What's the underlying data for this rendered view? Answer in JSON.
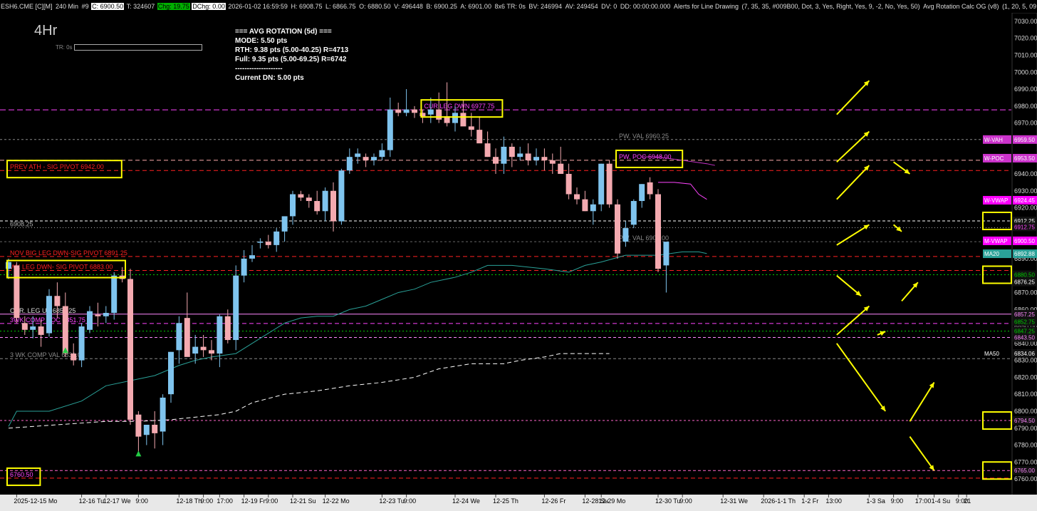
{
  "header": {
    "symbol": "ESH6.CME [C][M]",
    "interval": "240 Min",
    "bar_no": "#9",
    "close": "C: 6900.50",
    "total": "T: 324607",
    "change": "Chg: 19.75",
    "dchange": "DChg: 0.00",
    "datetime": "2026-01-02 16:59:59",
    "high": "H: 6908.75",
    "low": "L: 6866.75",
    "open": "O: 6880.50",
    "volume": "V: 496448",
    "bid": "B: 6900.25",
    "ask": "A: 6901.00",
    "bar_info": "8x6 TR: 0s",
    "bv": "BV: 246994",
    "av": "AV: 249454",
    "dv": "DV: 0",
    "dd": "DD: 00:00:00.000",
    "alerts": "Alerts for Line Drawing",
    "study_params": "(7, 35, 35, #009B00, Dot, 3, Yes, Right, Yes, 9, -2, No, Yes, 50)",
    "study2": "Avg Rotation Calc OG (v8)",
    "study2_params": "(1, 20, 5, 09:30:00, 16:00:00, 35"
  },
  "timeframe_label": "4Hr",
  "tr_label": "TR: 0s",
  "avg_rotation": {
    "title": "=== AVG ROTATION (5d) ===",
    "mode": "MODE: 5.50 pts",
    "rth": "RTH:  9.38 pts  (5.00-40.25) R=4713",
    "full": "Full: 9.35 pts  (5.00-69.25) R=6742",
    "sep": "--------------------",
    "current": "Current DN: 5.00 pts"
  },
  "colors": {
    "up_candle": "#7fc4ee",
    "down_candle": "#f4aab0",
    "level_red": "#ff2020",
    "level_magenta": "#ff44ff",
    "highlight": "#ffff00",
    "teal_line": "#2aa198"
  },
  "chart_data": {
    "type": "candlestick",
    "ylim": [
      6755,
      7035
    ],
    "y_ticks": [
      "7030.00",
      "7020.00",
      "7010.00",
      "7000.00",
      "6990.00",
      "6980.00",
      "6970.00",
      "6960.00",
      "6950.00",
      "6940.00",
      "6930.00",
      "6920.00",
      "6910.00",
      "6900.00",
      "6890.00",
      "6880.00",
      "6870.00",
      "6860.00",
      "6850.00",
      "6840.00",
      "6830.00",
      "6820.00",
      "6810.00",
      "6800.00",
      "6790.00",
      "6780.00",
      "6770.00",
      "6760.00"
    ],
    "x_labels": [
      {
        "i": 1,
        "t": "2025-12-15 Mo"
      },
      {
        "i": 9,
        "t": "12-16 Tu"
      },
      {
        "i": 12,
        "t": "12-17 We"
      },
      {
        "i": 16,
        "t": "9:00"
      },
      {
        "i": 21,
        "t": "12-18 Th"
      },
      {
        "i": 24,
        "t": "9:00"
      },
      {
        "i": 26,
        "t": "17:00"
      },
      {
        "i": 29,
        "t": "12-19 Fr"
      },
      {
        "i": 32,
        "t": "9:00"
      },
      {
        "i": 35,
        "t": "12-21 Su"
      },
      {
        "i": 39,
        "t": "12-22 Mo"
      },
      {
        "i": 46,
        "t": "12-23 Tu"
      },
      {
        "i": 49,
        "t": "9:00"
      },
      {
        "i": 55,
        "t": "12-24 We"
      },
      {
        "i": 60,
        "t": "12-25 Th"
      },
      {
        "i": 66,
        "t": "12-26 Fr"
      },
      {
        "i": 71,
        "t": "12-28 Su"
      },
      {
        "i": 73,
        "t": "12-29 Mo"
      },
      {
        "i": 80,
        "t": "12-30 Tu"
      },
      {
        "i": 83,
        "t": "9:00"
      },
      {
        "i": 88,
        "t": "12-31 We"
      },
      {
        "i": 93,
        "t": "2026-1-1 Th"
      },
      {
        "i": 98,
        "t": "1-2 Fr"
      },
      {
        "i": 101,
        "t": "13:00"
      },
      {
        "i": 106,
        "t": "1-3 Sa"
      },
      {
        "i": 109,
        "t": "9:00"
      },
      {
        "i": 112,
        "t": "17:00"
      },
      {
        "i": 114,
        "t": "1-4 Su"
      },
      {
        "i": 117,
        "t": "9:00"
      },
      {
        "i": 118,
        "t": "21"
      }
    ],
    "candles": [
      [
        6884,
        6890,
        6878,
        6888
      ],
      [
        6886,
        6888,
        6852,
        6855
      ],
      [
        6852,
        6856,
        6845,
        6848
      ],
      [
        6848,
        6856,
        6843,
        6850
      ],
      [
        6850,
        6854,
        6838,
        6845
      ],
      [
        6846,
        6872,
        6844,
        6868
      ],
      [
        6868,
        6876,
        6855,
        6862
      ],
      [
        6862,
        6870,
        6832,
        6834
      ],
      [
        6834,
        6840,
        6827,
        6830
      ],
      [
        6830,
        6852,
        6826,
        6850
      ],
      [
        6848,
        6862,
        6846,
        6859
      ],
      [
        6857,
        6864,
        6850,
        6856
      ],
      [
        6856,
        6862,
        6852,
        6858
      ],
      [
        6858,
        6882,
        6854,
        6880
      ],
      [
        6880,
        6885,
        6876,
        6878
      ],
      [
        6878,
        6884,
        6792,
        6795
      ],
      [
        6798,
        6800,
        6775,
        6785
      ],
      [
        6786,
        6792,
        6780,
        6792
      ],
      [
        6792,
        6800,
        6778,
        6787
      ],
      [
        6788,
        6810,
        6780,
        6808
      ],
      [
        6810,
        6835,
        6805,
        6835
      ],
      [
        6836,
        6856,
        6828,
        6852
      ],
      [
        6855,
        6870,
        6836,
        6832
      ],
      [
        6834,
        6845,
        6828,
        6838
      ],
      [
        6838,
        6845,
        6832,
        6836
      ],
      [
        6836,
        6842,
        6830,
        6834
      ],
      [
        6834,
        6857,
        6826,
        6856
      ],
      [
        6856,
        6860,
        6840,
        6842
      ],
      [
        6842,
        6886,
        6836,
        6880
      ],
      [
        6880,
        6895,
        6876,
        6890
      ],
      [
        6890,
        6898,
        6888,
        6892
      ],
      [
        6900,
        6902,
        6896,
        6900
      ],
      [
        6900,
        6904,
        6896,
        6898
      ],
      [
        6898,
        6908,
        6894,
        6906
      ],
      [
        6906,
        6914,
        6900,
        6915
      ],
      [
        6915,
        6930,
        6910,
        6928
      ],
      [
        6928,
        6930,
        6924,
        6926
      ],
      [
        6926,
        6928,
        6920,
        6924
      ],
      [
        6924,
        6930,
        6916,
        6918
      ],
      [
        6918,
        6932,
        6912,
        6930
      ],
      [
        6930,
        6935,
        6906,
        6912
      ],
      [
        6912,
        6943,
        6910,
        6942
      ],
      [
        6942,
        6955,
        6940,
        6950
      ],
      [
        6950,
        6955,
        6946,
        6952
      ],
      [
        6950,
        6952,
        6944,
        6948
      ],
      [
        6948,
        6952,
        6945,
        6950
      ],
      [
        6950,
        6958,
        6948,
        6954
      ],
      [
        6954,
        6985,
        6950,
        6978
      ],
      [
        6978,
        6982,
        6974,
        6976
      ],
      [
        6976,
        6990,
        6974,
        6978
      ],
      [
        6978,
        6980,
        6973,
        6976
      ],
      [
        6976,
        6978,
        6970,
        6974
      ],
      [
        6975,
        6985,
        6970,
        6978
      ],
      [
        6978,
        6988,
        6970,
        6972
      ],
      [
        6974,
        6994,
        6968,
        6970
      ],
      [
        6970,
        6980,
        6965,
        6976
      ],
      [
        6976,
        6984,
        6972,
        6968
      ],
      [
        6968,
        6976,
        6962,
        6966
      ],
      [
        6966,
        6974,
        6960,
        6958
      ],
      [
        6958,
        6965,
        6950,
        6950
      ],
      [
        6950,
        6955,
        6940,
        6946
      ],
      [
        6946,
        6962,
        6940,
        6956
      ],
      [
        6956,
        6958,
        6944,
        6950
      ],
      [
        6950,
        6956,
        6948,
        6952
      ],
      [
        6952,
        6958,
        6945,
        6948
      ],
      [
        6948,
        6955,
        6945,
        6950
      ],
      [
        6950,
        6955,
        6942,
        6948
      ],
      [
        6948,
        6952,
        6940,
        6946
      ],
      [
        6946,
        6956,
        6940,
        6940
      ],
      [
        6940,
        6946,
        6925,
        6928
      ],
      [
        6928,
        6932,
        6922,
        6925
      ],
      [
        6925,
        6930,
        6918,
        6918
      ],
      [
        6918,
        6925,
        6910,
        6922
      ],
      [
        6922,
        6946,
        6918,
        6946
      ],
      [
        6946,
        6948,
        6920,
        6922
      ],
      [
        6922,
        6925,
        6890,
        6893
      ],
      [
        6900,
        6912,
        6897,
        6908
      ],
      [
        6910,
        6925,
        6908,
        6924
      ],
      [
        6924,
        6934,
        6920,
        6934
      ],
      [
        6935,
        6938,
        6925,
        6928
      ],
      [
        6928,
        6931,
        6882,
        6884
      ],
      [
        6886,
        6898,
        6870,
        6900
      ]
    ],
    "levels": [
      {
        "price": 6977.75,
        "color": "#ff44ff",
        "dash": "8,4",
        "label": "CUR LEG DWN  6977.75",
        "label_color": "#ff44ff",
        "label_i": 51,
        "highlight": true
      },
      {
        "price": 6960.25,
        "color": "#888888",
        "dash": "3,3",
        "label": "PW. VAL  6960.25",
        "label_color": "#888888",
        "label_i": 75,
        "highlight": false
      },
      {
        "price": 6948.0,
        "color": "#ffaaaa",
        "dash": "6,4",
        "label": "PW. POC  6948.00",
        "label_color": "#ff44ff",
        "label_i": 75,
        "highlight": true
      },
      {
        "price": 6942.0,
        "color": "#ff2020",
        "dash": "6,4",
        "label": "PREV ATH - SIG PIVOT  6942.00",
        "label_color": "#ff2020",
        "label_i": 0,
        "highlight": true
      },
      {
        "price": 6912.25,
        "color": "#ffffff",
        "dash": "4,3",
        "label": "",
        "label_color": "#fff",
        "label_i": 0,
        "highlight": false
      },
      {
        "price": 6908.25,
        "color": "#aaaaaa",
        "dash": "1,3",
        "label": "6908.25",
        "label_color": "#aaaaaa",
        "label_i": 0,
        "highlight": false
      },
      {
        "price": 6900.0,
        "color": "#666666",
        "dash": "3,3",
        "label": "PW. VAL  6900.00",
        "label_color": "#888888",
        "label_i": 75,
        "highlight": false
      },
      {
        "price": 6891.25,
        "color": "#ff2020",
        "dash": "6,4",
        "label": "NOV BIG LEG DWN-SIG PIVOT  6891.25",
        "label_color": "#ff2020",
        "label_i": 0,
        "highlight": false
      },
      {
        "price": 6883.0,
        "color": "#ff2020",
        "dash": "6,4",
        "label": "WK LEG DWN- SIG PIVOT  6883.00",
        "label_color": "#ff2020",
        "label_i": 0,
        "highlight": true
      },
      {
        "price": 6880.5,
        "color": "#00cc00",
        "dash": "2,3",
        "label": "",
        "label_color": "#0f0",
        "label_i": 0,
        "highlight": false
      },
      {
        "price": 6857.25,
        "color": "#ff88ff",
        "dash": "",
        "label": "CUR. LEG UP  6857.25",
        "label_color": "#dddddd",
        "label_i": 0,
        "highlight": false
      },
      {
        "price": 6851.75,
        "color": "#ff44ff",
        "dash": "6,4",
        "label": "3WK COMP POC  6851.75",
        "label_color": "#ff44ff",
        "label_i": 0,
        "highlight": false
      },
      {
        "price": 6847.25,
        "color": "#00cc00",
        "dash": "2,3",
        "label": "",
        "label_color": "#0f0",
        "label_i": 0,
        "highlight": false
      },
      {
        "price": 6843.5,
        "color": "#ff88ff",
        "dash": "4,3",
        "label": "",
        "label_color": "#ff88ff",
        "label_i": 0,
        "highlight": false
      },
      {
        "price": 6831.0,
        "color": "#888888",
        "dash": "4,3",
        "label": "3 WK COMP VAL  6831.00",
        "label_color": "#888888",
        "label_i": 0,
        "highlight": false
      },
      {
        "price": 6794.5,
        "color": "#ff66cc",
        "dash": "3,3",
        "label": "",
        "label_color": "#ff66cc",
        "label_i": 0,
        "highlight": false
      },
      {
        "price": 6765.0,
        "color": "#ff66cc",
        "dash": "4,3",
        "label": "",
        "label_color": "#ff66cc",
        "label_i": 0,
        "highlight": false
      },
      {
        "price": 6760.5,
        "color": "#ff2020",
        "dash": "6,4",
        "label": "6760.50",
        "label_color": "#ff44ff",
        "label_i": 0,
        "highlight": true
      }
    ],
    "right_tags": [
      {
        "price": 6960.25,
        "text": "W-VAH",
        "bg": "#cc33cc",
        "fg": "#ffffff",
        "val": "6959.50"
      },
      {
        "price": 6949.25,
        "text": "W-POC",
        "bg": "#cc33cc",
        "fg": "#ffffff",
        "val": "6953.50"
      },
      {
        "price": 6924.45,
        "text": "W-VWAP",
        "bg": "#ff00ff",
        "fg": "#ffffff",
        "val": "6924.45"
      },
      {
        "price": 6912.25,
        "text": "",
        "bg": "#000000",
        "fg": "#ffffff",
        "val": "6912.25"
      },
      {
        "price": 6908.75,
        "text": "",
        "bg": "#000000",
        "fg": "#ff44ff",
        "val": "6912.75"
      },
      {
        "price": 6900.5,
        "text": "M-VWAP",
        "bg": "#ff00ff",
        "fg": "#ffffff",
        "val": "6900.50"
      },
      {
        "price": 6892.88,
        "text": "MA20",
        "bg": "#2aa198",
        "fg": "#ffffff",
        "val": "6892.88"
      },
      {
        "price": 6880.5,
        "text": "",
        "bg": "#000000",
        "fg": "#00cc00",
        "val": "6880.50"
      },
      {
        "price": 6876.25,
        "text": "",
        "bg": "#000000",
        "fg": "#ffffff",
        "val": "6876.25"
      },
      {
        "price": 6857.25,
        "text": "",
        "bg": "#000000",
        "fg": "#ff88ff",
        "val": "6857.25"
      },
      {
        "price": 6852.75,
        "text": "",
        "bg": "#000000",
        "fg": "#00cc00",
        "val": "6852.75"
      },
      {
        "price": 6847.25,
        "text": "",
        "bg": "#000000",
        "fg": "#00cc00",
        "val": "6847.25"
      },
      {
        "price": 6843.5,
        "text": "",
        "bg": "#000000",
        "fg": "#ff88ff",
        "val": "6843.50"
      },
      {
        "price": 6834.06,
        "text": "MA50",
        "bg": "#000000",
        "fg": "#ffffff",
        "val": "6834.06"
      },
      {
        "price": 6794.5,
        "text": "",
        "bg": "#000000",
        "fg": "#ff88ff",
        "val": "6794.50"
      },
      {
        "price": 6765.0,
        "text": "",
        "bg": "#000000",
        "fg": "#ff88ff",
        "val": "6765.00"
      }
    ],
    "ma20_points": [
      [
        0,
        6791
      ],
      [
        1,
        6800
      ],
      [
        5,
        6800
      ],
      [
        9,
        6806
      ],
      [
        12,
        6815
      ],
      [
        15,
        6818
      ],
      [
        18,
        6821
      ],
      [
        21,
        6827
      ],
      [
        23,
        6830
      ],
      [
        25,
        6832
      ],
      [
        28,
        6834
      ],
      [
        30,
        6840
      ],
      [
        32,
        6846
      ],
      [
        34,
        6852
      ],
      [
        36,
        6855
      ],
      [
        38,
        6856
      ],
      [
        40,
        6856
      ],
      [
        42,
        6860
      ],
      [
        44,
        6862
      ],
      [
        46,
        6866
      ],
      [
        48,
        6870
      ],
      [
        50,
        6872
      ],
      [
        52,
        6876
      ],
      [
        55,
        6879
      ],
      [
        57,
        6882
      ],
      [
        59,
        6886
      ],
      [
        62,
        6886
      ],
      [
        66,
        6884
      ],
      [
        69,
        6882
      ],
      [
        71,
        6886
      ],
      [
        73,
        6888
      ],
      [
        76,
        6892
      ],
      [
        80,
        6892
      ],
      [
        83,
        6894
      ],
      [
        85,
        6894
      ],
      [
        86,
        6893
      ]
    ],
    "ma50_points": [
      [
        0,
        6790
      ],
      [
        6,
        6792
      ],
      [
        12,
        6794
      ],
      [
        16,
        6794
      ],
      [
        20,
        6795
      ],
      [
        24,
        6797
      ],
      [
        26,
        6798
      ],
      [
        28,
        6800
      ],
      [
        30,
        6805
      ],
      [
        34,
        6810
      ],
      [
        38,
        6812
      ],
      [
        42,
        6815
      ],
      [
        46,
        6817
      ],
      [
        50,
        6820
      ],
      [
        53,
        6825
      ],
      [
        57,
        6828
      ],
      [
        61,
        6828
      ],
      [
        63,
        6830
      ],
      [
        66,
        6832
      ],
      [
        68,
        6834
      ],
      [
        69,
        6834
      ],
      [
        74,
        6834
      ]
    ],
    "vwap_w_points": [
      [
        78,
        6950
      ],
      [
        80,
        6950
      ],
      [
        83,
        6948
      ],
      [
        86,
        6946
      ],
      [
        87,
        6945
      ]
    ],
    "vwap_m_points": [
      [
        80,
        6935
      ],
      [
        82,
        6935
      ],
      [
        84,
        6934
      ],
      [
        85,
        6928
      ],
      [
        86,
        6925
      ]
    ],
    "arrows": [
      [
        102,
        6975,
        106,
        6995
      ],
      [
        102,
        6947,
        106,
        6965
      ],
      [
        102,
        6925,
        106,
        6945
      ],
      [
        109,
        6947,
        111,
        6940
      ],
      [
        102,
        6898,
        106,
        6910
      ],
      [
        109,
        6910,
        110,
        6906
      ],
      [
        102,
        6880,
        105,
        6868
      ],
      [
        102,
        6845,
        106,
        6862
      ],
      [
        110,
        6865,
        112,
        6876
      ],
      [
        102,
        6840,
        108,
        6800
      ],
      [
        111,
        6794,
        114,
        6817
      ],
      [
        111,
        6785,
        114,
        6765
      ],
      [
        107,
        6845,
        108,
        6847
      ]
    ],
    "highlight_boxes": [
      {
        "x1": 0.1,
        "y": 6942.0,
        "w": 135
      },
      {
        "x1": 0.1,
        "y": 6883.0,
        "w": 142
      },
      {
        "x1": 0.1,
        "y": 6760.5,
        "w": 40
      }
    ],
    "small_markers": [
      {
        "i": 7,
        "price": 6836,
        "kind": "up"
      },
      {
        "i": 16,
        "price": 6775,
        "kind": "up"
      }
    ]
  }
}
